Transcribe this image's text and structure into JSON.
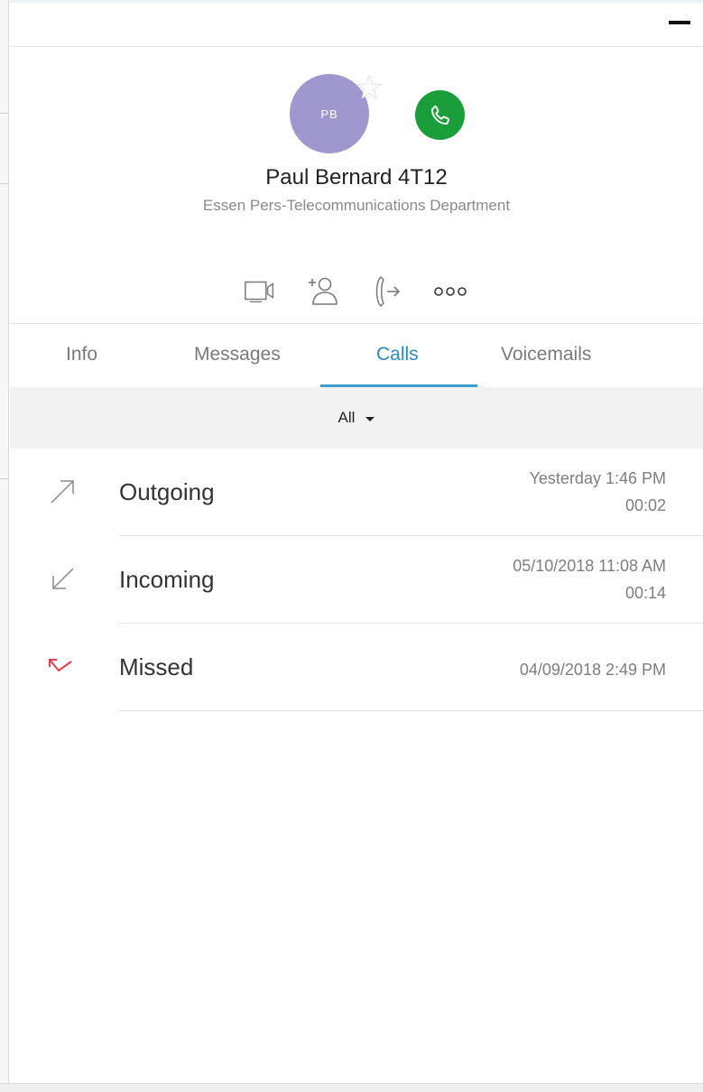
{
  "contact": {
    "initials": "PB",
    "name": "Paul Bernard 4T12",
    "department": "Essen Pers-Telecommunications Department"
  },
  "tabs": [
    {
      "label": "Info"
    },
    {
      "label": "Messages"
    },
    {
      "label": "Calls",
      "active": true
    },
    {
      "label": "Voicemails"
    }
  ],
  "filter": {
    "label": "All"
  },
  "calls": [
    {
      "type": "Outgoing",
      "when": "Yesterday 1:46 PM",
      "duration": "00:02",
      "icon": "outgoing-arrow-icon"
    },
    {
      "type": "Incoming",
      "when": "05/10/2018 11:08 AM",
      "duration": "00:14",
      "icon": "incoming-arrow-icon"
    },
    {
      "type": "Missed",
      "when": "04/09/2018 2:49 PM",
      "duration": "",
      "icon": "missed-call-icon"
    }
  ],
  "colors": {
    "avatar": "#9e98cf",
    "call_button": "#1a9e3a",
    "active_tab": "#2a8ac0",
    "missed": "#e0404a"
  }
}
